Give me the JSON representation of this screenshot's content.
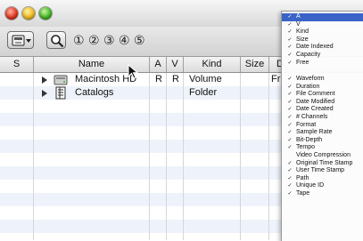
{
  "window": {
    "toolbar": {
      "numbers": [
        "①",
        "②",
        "③",
        "④",
        "⑤"
      ]
    }
  },
  "columns": {
    "s": "S",
    "name": "Name",
    "a": "A",
    "v": "V",
    "kind": "Kind",
    "size": "Size",
    "d": "D"
  },
  "rows": [
    {
      "name": "Macintosh HD",
      "a": "R",
      "v": "R",
      "kind": "Volume",
      "d": "Fri",
      "icon": "hard-drive-icon"
    },
    {
      "name": "Catalogs",
      "a": "",
      "v": "",
      "kind": "Folder",
      "d": "",
      "icon": "catalog-icon"
    }
  ],
  "menu": {
    "group1": [
      {
        "label": "A",
        "checked": true,
        "selected": true
      },
      {
        "label": "V",
        "checked": true
      },
      {
        "label": "Kind",
        "checked": true
      },
      {
        "label": "Size",
        "checked": true
      },
      {
        "label": "Date Indexed",
        "checked": true
      },
      {
        "label": "Capacity",
        "checked": true
      },
      {
        "label": "Free",
        "checked": true
      }
    ],
    "group2": [
      {
        "label": "Waveform",
        "checked": true
      },
      {
        "label": "Duration",
        "checked": true
      },
      {
        "label": "File Comment",
        "checked": true
      },
      {
        "label": "Date Modified",
        "checked": true
      },
      {
        "label": "Date Created",
        "checked": true
      },
      {
        "label": "# Channels",
        "checked": true
      },
      {
        "label": "Format",
        "checked": true
      },
      {
        "label": "Sample Rate",
        "checked": true
      },
      {
        "label": "Bit-Depth",
        "checked": true
      },
      {
        "label": "Tempo",
        "checked": true
      },
      {
        "label": "Video Compression",
        "checked": false
      },
      {
        "label": "Original Time Stamp",
        "checked": true
      },
      {
        "label": "User Time Stamp",
        "checked": true
      },
      {
        "label": "Path",
        "checked": true
      },
      {
        "label": "Unique ID",
        "checked": true
      },
      {
        "label": "Tape",
        "checked": true
      }
    ],
    "check_glyph": "✓"
  },
  "colors": {
    "menu_highlight": "#3a63c7",
    "row_alt": "#eef3fb"
  }
}
